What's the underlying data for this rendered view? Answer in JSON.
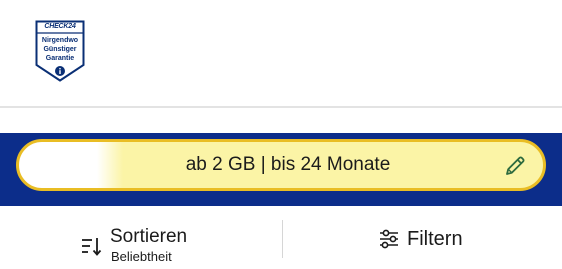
{
  "badge": {
    "brand": "CHECK24",
    "lines": [
      "Nirgendwo",
      "Günstiger",
      "Garantie"
    ],
    "info_icon": "info-icon",
    "color": "#0a2f75"
  },
  "search": {
    "text": "ab 2 GB | bis 24 Monate",
    "edit_icon": "pencil-icon",
    "band_color": "#0c2d8a",
    "highlight_color": "#fbf4a6",
    "border_color": "#e9bd24"
  },
  "toolbar": {
    "sort_label": "Sortieren",
    "sort_value": "Beliebtheit",
    "sort_icon": "sort-icon",
    "filter_label": "Filtern",
    "filter_icon": "sliders-icon"
  }
}
